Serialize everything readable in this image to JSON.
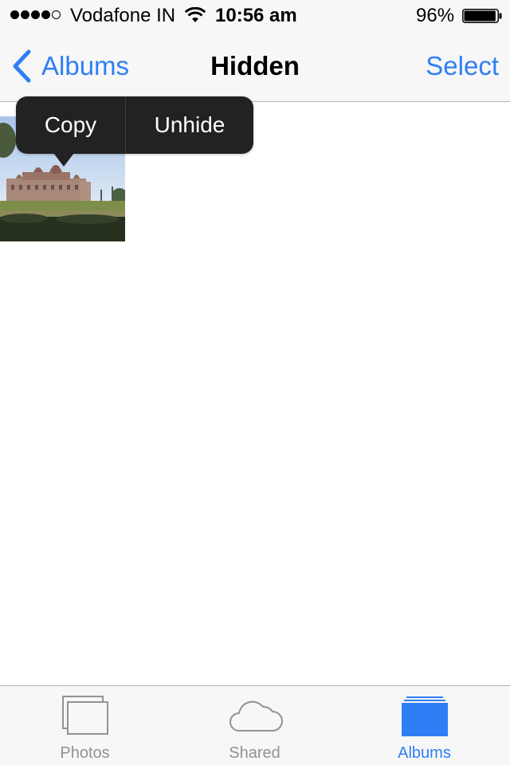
{
  "status_bar": {
    "signal_bars_filled": 4,
    "signal_bars_total": 5,
    "carrier": "Vodafone IN",
    "time": "10:56 am",
    "battery_percent": "96%",
    "battery_level": 0.96
  },
  "nav": {
    "back_label": "Albums",
    "title": "Hidden",
    "select_label": "Select"
  },
  "edit_menu": {
    "copy_label": "Copy",
    "unhide_label": "Unhide"
  },
  "tab_bar": {
    "tabs": [
      {
        "label": "Photos",
        "icon": "photos-icon",
        "active": false
      },
      {
        "label": "Shared",
        "icon": "cloud-icon",
        "active": false
      },
      {
        "label": "Albums",
        "icon": "albums-icon",
        "active": true
      }
    ]
  },
  "colors": {
    "accent": "#2f7ef6",
    "menu_background": "#222222",
    "bar_background": "#f7f7f7",
    "inactive_tab": "#929292"
  }
}
